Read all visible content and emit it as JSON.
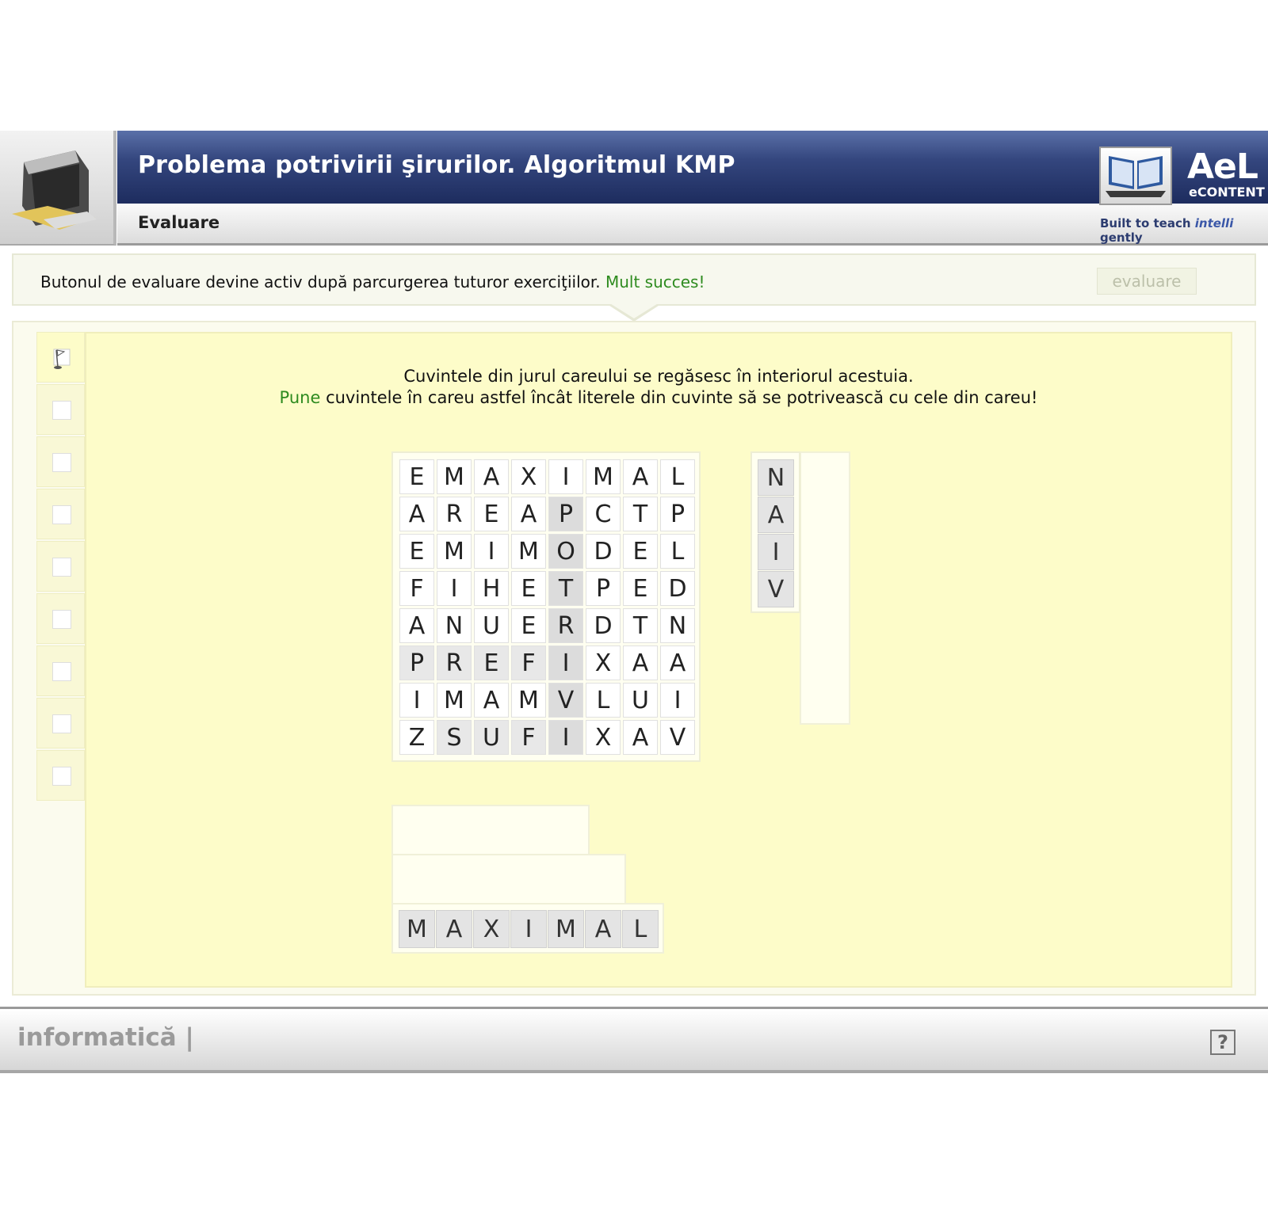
{
  "header": {
    "title": "Problema potrivirii şirurilor. Algoritmul KMP",
    "subtitle": "Evaluare",
    "brand_title": "AeL",
    "brand_sub": "eCONTENT",
    "tagline_a": "Built to teach ",
    "tagline_b": "intelli",
    "tagline_c": " gently"
  },
  "info": {
    "text": "Butonul de evaluare devine activ după parcurgerea tuturor exerciţiilor. ",
    "highlight": "Mult succes!",
    "evaluate_label": "evaluare"
  },
  "instructions": {
    "line1": "Cuvintele din jurul careului se regăsesc în interiorul acestuia.",
    "line2_green": "Pune",
    "line2_rest": " cuvintele în careu astfel încât literele din cuvinte să se potrivească cu cele din careu!"
  },
  "grid": [
    [
      "E",
      "M",
      "A",
      "X",
      "I",
      "M",
      "A",
      "L"
    ],
    [
      "A",
      "R",
      "E",
      "A",
      "P",
      "C",
      "T",
      "P"
    ],
    [
      "E",
      "M",
      "I",
      "M",
      "O",
      "D",
      "E",
      "L"
    ],
    [
      "F",
      "I",
      "H",
      "E",
      "T",
      "P",
      "E",
      "D"
    ],
    [
      "A",
      "N",
      "U",
      "E",
      "R",
      "D",
      "T",
      "N"
    ],
    [
      "P",
      "R",
      "E",
      "F",
      "I",
      "X",
      "A",
      "A"
    ],
    [
      "I",
      "M",
      "A",
      "M",
      "V",
      "L",
      "U",
      "I"
    ],
    [
      "Z",
      "S",
      "U",
      "F",
      "I",
      "X",
      "A",
      "V"
    ]
  ],
  "word_vertical": [
    "N",
    "A",
    "I",
    "V"
  ],
  "word_horizontal": [
    "M",
    "A",
    "X",
    "I",
    "M",
    "A",
    "L"
  ],
  "footer": {
    "subject": "informatică  |",
    "help": "?"
  },
  "sidebar_count": 9
}
